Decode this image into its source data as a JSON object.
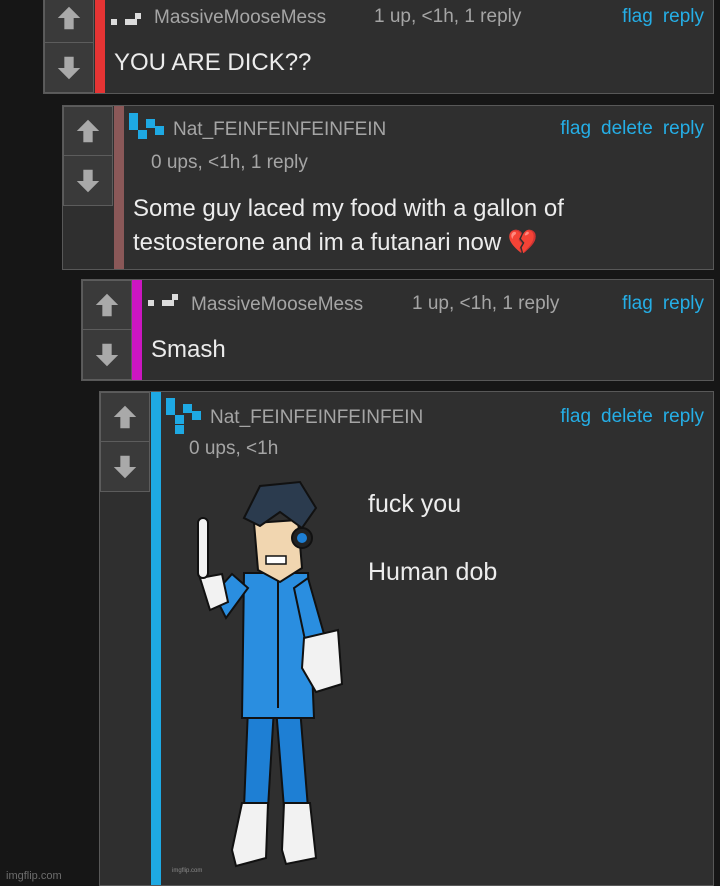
{
  "comments": [
    {
      "username": "MassiveMooseMess",
      "meta": "1 up, <1h, 1 reply",
      "actions": {
        "flag": "flag",
        "reply": "reply"
      },
      "text": "YOU ARE DICK??",
      "stripe_color": "#e53434",
      "avatar": "pixel-avatar-grey-icon"
    },
    {
      "username": "Nat_FEINFEINFEINFEIN",
      "meta": "0 ups, <1h, 1 reply",
      "actions": {
        "flag": "flag",
        "delete": "delete",
        "reply": "reply"
      },
      "text_line1": "Some guy laced my food with a gallon of",
      "text_line2": "testosterone and im a futanari now",
      "emoji": "💔",
      "stripe_color": "#8a5858",
      "avatar": "pixel-avatar-blue-icon"
    },
    {
      "username": "MassiveMooseMess",
      "meta": "1 up, <1h, 1 reply",
      "actions": {
        "flag": "flag",
        "reply": "reply"
      },
      "text": "Smash",
      "stripe_color": "#cc16c2",
      "avatar": "pixel-avatar-grey-icon"
    },
    {
      "username": "Nat_FEINFEINFEINFEIN",
      "meta": "0 ups, <1h",
      "actions": {
        "flag": "flag",
        "delete": "delete",
        "reply": "reply"
      },
      "image_text_line1": "fuck you",
      "image_text_line2": "Human dob",
      "image_watermark": "imgflip.com",
      "stripe_color": "#1ea9e3",
      "avatar": "pixel-avatar-blue-icon"
    }
  ],
  "site_watermark": "imgflip.com",
  "colors": {
    "link": "#25aee6",
    "bg": "#161616",
    "card": "#2f2f2f"
  }
}
